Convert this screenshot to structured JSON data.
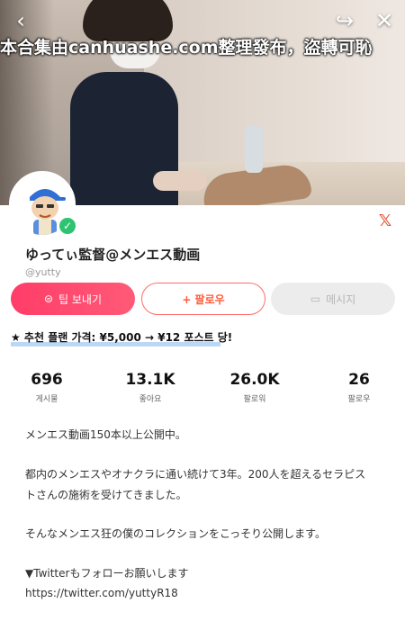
{
  "header": {
    "back_icon": "chevron-left-icon",
    "share_icon": "share-icon",
    "close_icon": "close-icon"
  },
  "watermark": "本合集由canhuashe.com整理發布，盜轉可恥",
  "profile": {
    "name": "ゆってぃ監督@メンエス動画",
    "handle": "@yutty",
    "verified": true,
    "brand_icon": "x-logo-icon"
  },
  "actions": {
    "tip_label": "팁 보내기",
    "follow_label": "+ 팔로우",
    "message_label": "메시지"
  },
  "plan": {
    "text": "★ 추천 플랜 가격: ¥5,000 → ¥12 포스트 당!"
  },
  "stats": [
    {
      "value": "696",
      "label": "게시물"
    },
    {
      "value": "13.1K",
      "label": "좋아요"
    },
    {
      "value": "26.0K",
      "label": "팔로워"
    },
    {
      "value": "26",
      "label": "팔로우"
    }
  ],
  "bio": {
    "line1": "メンエス動画150本以上公開中。",
    "line2": "都内のメンエスやオナクラに通い続けて3年。200人を超えるセラピス",
    "line3": "トさんの施術を受けてきました。",
    "line4": "そんなメンエス狂の僕のコレクションをこっそり公開します。",
    "line5": "▼Twitterもフォローお願いします",
    "link": "https://twitter.com/yuttyR18"
  },
  "colors": {
    "tip_button": "#ff3d68",
    "follow_border": "#ff6b6b",
    "verified": "#2ec371",
    "plan_highlight": "#a9cdf1"
  }
}
